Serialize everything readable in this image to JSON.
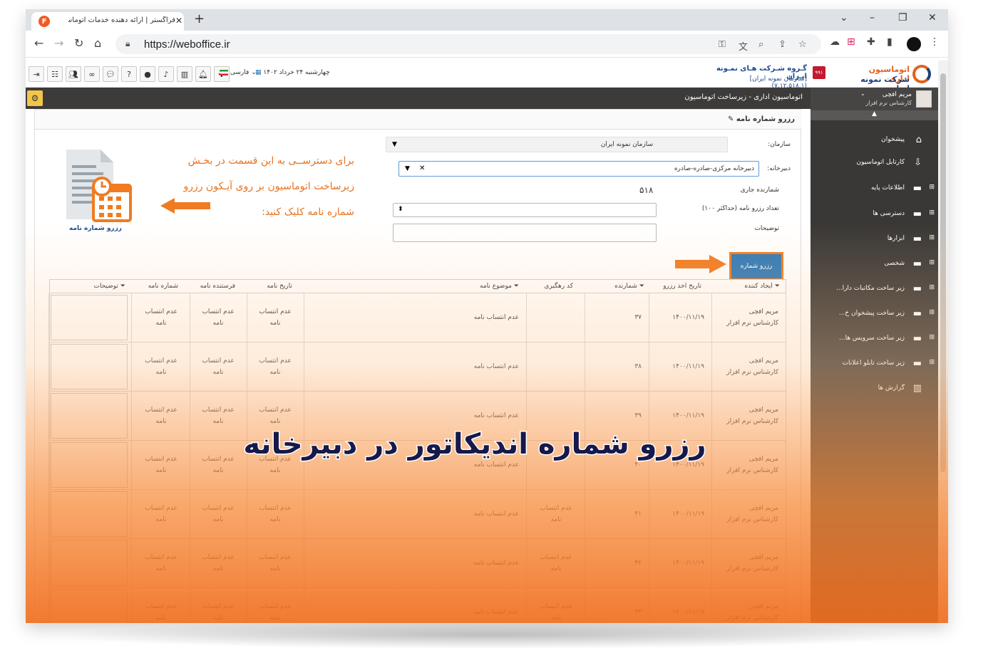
{
  "browser": {
    "tab_title": "فراگستر | ارائه دهنده خدمات اتوماسیون اداری",
    "url": "https://weboffice.ir"
  },
  "header": {
    "tools": [
      "exit-icon",
      "org-chart-icon",
      "group-icon",
      "link-icon",
      "chat-icon",
      "help-icon",
      "user-icon",
      "mic-icon",
      "chart-icon",
      "bell-icon",
      "puzzle-icon"
    ],
    "language": "فارسی",
    "date": "چهارشنبه ۲۴ خرداد ۱۴۰۲",
    "org_title": "گـروه شـرکت هـای نمـونه ایـران",
    "org_sub": "[سازمان نمونه ایران] (۷.۱۲.۵۱۸.۱)",
    "org_badge": "۹۹۱",
    "brand_line1": "اتوماسیون اداری",
    "brand_line2": "شرکت نمونه ایران"
  },
  "darkbar": {
    "breadcrumb": "اتوماسیون اداری - زیرساخت اتوماسیون"
  },
  "sidebar": {
    "user_name": "مریم افچی",
    "user_role": "کارشناس نرم افزار",
    "items": [
      {
        "label": "پیشخوان",
        "icon": "home-icon",
        "plus": ""
      },
      {
        "label": "کارتابل اتوماسیون",
        "icon": "inbox-icon",
        "plus": ""
      },
      {
        "label": "اطلاعات پایه",
        "icon": "folder-icon",
        "plus": "⊞"
      },
      {
        "label": "دسترسی ها",
        "icon": "folder-icon",
        "plus": "⊞"
      },
      {
        "label": "ابزارها",
        "icon": "folder-icon",
        "plus": "⊞"
      },
      {
        "label": "شخصی",
        "icon": "folder-icon",
        "plus": "⊞"
      },
      {
        "label": "زیر ساخت مکاتبات دارا...",
        "icon": "folder-icon",
        "plus": "⊞"
      },
      {
        "label": "زیر ساخت پیشخوان خ...",
        "icon": "folder-icon",
        "plus": "⊞"
      },
      {
        "label": "زیر ساخت سرویس ها...",
        "icon": "folder-icon",
        "plus": "⊞"
      },
      {
        "label": "زیر ساخت تابلو اعلانات",
        "icon": "folder-icon",
        "plus": "⊞"
      },
      {
        "label": "گزارش ها",
        "icon": "report-icon",
        "plus": ""
      }
    ]
  },
  "panel": {
    "title": "رزرو شماره نامه",
    "org_label": "سازمان:",
    "org_value": "سازمان نمونه ایران",
    "secretariat_label": "دبیرخانه:",
    "secretariat_value": "دبیرخانه مرکزی-صادره-صادره",
    "counter_label": "شمارنده جاری",
    "counter_value": "۵۱۸",
    "count_label": "تعداد رزرو نامه (حداکثر ۱۰۰)",
    "notes_label": "توضیحات",
    "reserve_button": "رزرو شماره"
  },
  "annotation": {
    "line1": "برای دسترســی به این قسمت در بخـش",
    "line2": "زیرساخت اتوماسیون بر روی آیـکون رزرو",
    "line3": "شماره نامه کلیک کنید:",
    "icon_label": "رزرو شماره نامه"
  },
  "table": {
    "headers": {
      "creator": "ایجاد کننده",
      "reserve_date": "تاریخ اخذ رزرو",
      "counter": "شمارنده",
      "tracking": "کد رهگیری",
      "subject": "موضوع نامه",
      "letter_date": "تاریخ نامه",
      "sender": "فرستنده نامه",
      "letter_no": "شماره نامه",
      "notes": "توضیحات"
    },
    "rows": [
      {
        "creator_name": "مریم افچی",
        "creator_role": "کارشناس نرم افزار",
        "reserve_date": "۱۴۰۰/۱۱/۱۹",
        "counter": "۳۷",
        "tracking": "",
        "subject": "عدم انتساب نامه",
        "letter_date": "عدم انتساب نامه",
        "sender": "عدم انتساب نامه",
        "letter_no": "عدم انتساب نامه"
      },
      {
        "creator_name": "مریم افچی",
        "creator_role": "کارشناس نرم افزار",
        "reserve_date": "۱۴۰۰/۱۱/۱۹",
        "counter": "۳۸",
        "tracking": "",
        "subject": "عدم انتساب نامه",
        "letter_date": "عدم انتساب نامه",
        "sender": "عدم انتساب نامه",
        "letter_no": "عدم انتساب نامه"
      },
      {
        "creator_name": "مریم افچی",
        "creator_role": "کارشناس نرم افزار",
        "reserve_date": "۱۴۰۰/۱۱/۱۹",
        "counter": "۳۹",
        "tracking": "",
        "subject": "عدم انتساب نامه",
        "letter_date": "عدم انتساب نامه",
        "sender": "عدم انتساب نامه",
        "letter_no": "عدم انتساب نامه"
      },
      {
        "creator_name": "مریم افچی",
        "creator_role": "کارشناس نرم افزار",
        "reserve_date": "۱۴۰۰/۱۱/۱۹",
        "counter": "۴۰",
        "tracking": "",
        "subject": "عدم انتساب نامه",
        "letter_date": "عدم انتساب نامه",
        "sender": "عدم انتساب نامه",
        "letter_no": "عدم انتساب نامه"
      },
      {
        "creator_name": "مریم افچی",
        "creator_role": "کارشناس نرم افزار",
        "reserve_date": "۱۴۰۰/۱۱/۱۹",
        "counter": "۴۱",
        "tracking": "عدم انتساب نامه",
        "subject": "عدم انتساب نامه",
        "letter_date": "عدم انتساب نامه",
        "sender": "عدم انتساب نامه",
        "letter_no": "عدم انتساب نامه"
      },
      {
        "creator_name": "مریم افچی",
        "creator_role": "کارشناس نرم افزار",
        "reserve_date": "۱۴۰۰/۱۱/۱۹",
        "counter": "۴۲",
        "tracking": "عدم انتساب نامه",
        "subject": "عدم انتساب نامه",
        "letter_date": "عدم انتساب نامه",
        "sender": "عدم انتساب نامه",
        "letter_no": "عدم انتساب نامه"
      },
      {
        "creator_name": "مریم افچی",
        "creator_role": "کارشناس نرم افزار",
        "reserve_date": "۱۴۰۰/۱۱/۱۹",
        "counter": "۴۳",
        "tracking": "عدم انتساب نامه",
        "subject": "عدم انتساب نامه",
        "letter_date": "عدم انتساب نامه",
        "sender": "عدم انتساب نامه",
        "letter_no": "عدم انتساب نامه"
      }
    ]
  },
  "overlay_title": "رزرو شماره اندیکاتور در دبیرخانه",
  "colors": {
    "accent": "#f07b21",
    "primary_button": "#2f79b6",
    "sidebar": "#3a3836",
    "title_text": "#16194a"
  }
}
